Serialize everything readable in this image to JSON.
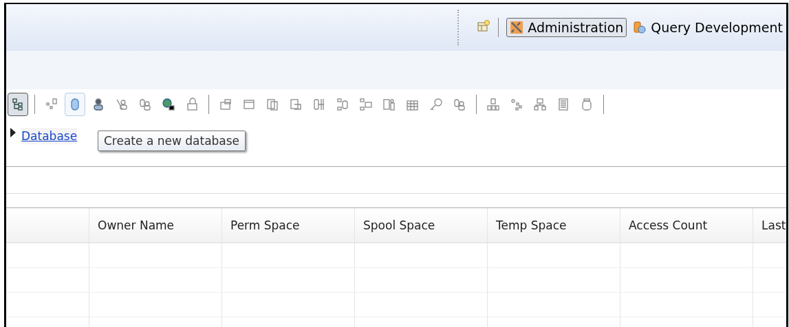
{
  "perspectives": [
    {
      "label": "Administration",
      "selected": true
    },
    {
      "label": "Query Development",
      "selected": false
    }
  ],
  "toolbar": {
    "tree_toggle": {
      "selected": true
    }
  },
  "breadcrumb": {
    "label": "Database"
  },
  "tooltip": {
    "text": "Create a new database"
  },
  "table": {
    "columns": [
      "Owner Name",
      "Perm Space",
      "Spool Space",
      "Temp Space",
      "Access Count",
      "Last"
    ]
  }
}
